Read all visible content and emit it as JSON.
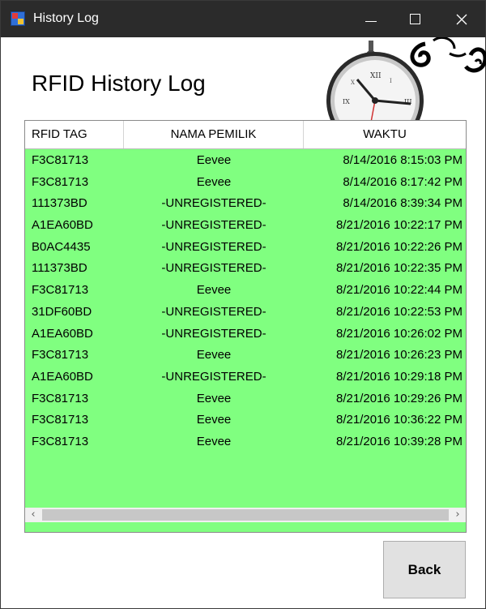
{
  "window": {
    "title": "History Log",
    "icon": "app-icon",
    "controls": {
      "minimize": "minimize-icon",
      "maximize": "maximize-icon",
      "close": "close-icon"
    }
  },
  "heading": "RFID History Log",
  "table": {
    "columns": [
      "RFID TAG",
      "NAMA PEMILIK",
      "WAKTU"
    ],
    "rows": [
      [
        "F3C81713",
        "Eevee",
        "8/14/2016 8:15:03 PM"
      ],
      [
        "F3C81713",
        "Eevee",
        "8/14/2016 8:17:42 PM"
      ],
      [
        "111373BD",
        "-UNREGISTERED-",
        "8/14/2016 8:39:34 PM"
      ],
      [
        "A1EA60BD",
        "-UNREGISTERED-",
        "8/21/2016 10:22:17 PM"
      ],
      [
        "B0AC4435",
        "-UNREGISTERED-",
        "8/21/2016 10:22:26 PM"
      ],
      [
        "111373BD",
        "-UNREGISTERED-",
        "8/21/2016 10:22:35 PM"
      ],
      [
        "F3C81713",
        "Eevee",
        "8/21/2016 10:22:44 PM"
      ],
      [
        "31DF60BD",
        "-UNREGISTERED-",
        "8/21/2016 10:22:53 PM"
      ],
      [
        "A1EA60BD",
        "-UNREGISTERED-",
        "8/21/2016 10:26:02 PM"
      ],
      [
        "F3C81713",
        "Eevee",
        "8/21/2016 10:26:23 PM"
      ],
      [
        "A1EA60BD",
        "-UNREGISTERED-",
        "8/21/2016 10:29:18 PM"
      ],
      [
        "F3C81713",
        "Eevee",
        "8/21/2016 10:29:26 PM"
      ],
      [
        "F3C81713",
        "Eevee",
        "8/21/2016 10:36:22 PM"
      ],
      [
        "F3C81713",
        "Eevee",
        "8/21/2016 10:39:28 PM"
      ]
    ]
  },
  "buttons": {
    "back": "Back"
  },
  "colors": {
    "titlebar": "#2b2b2b",
    "grid_background": "#80ff80",
    "button_face": "#e1e1e1"
  }
}
